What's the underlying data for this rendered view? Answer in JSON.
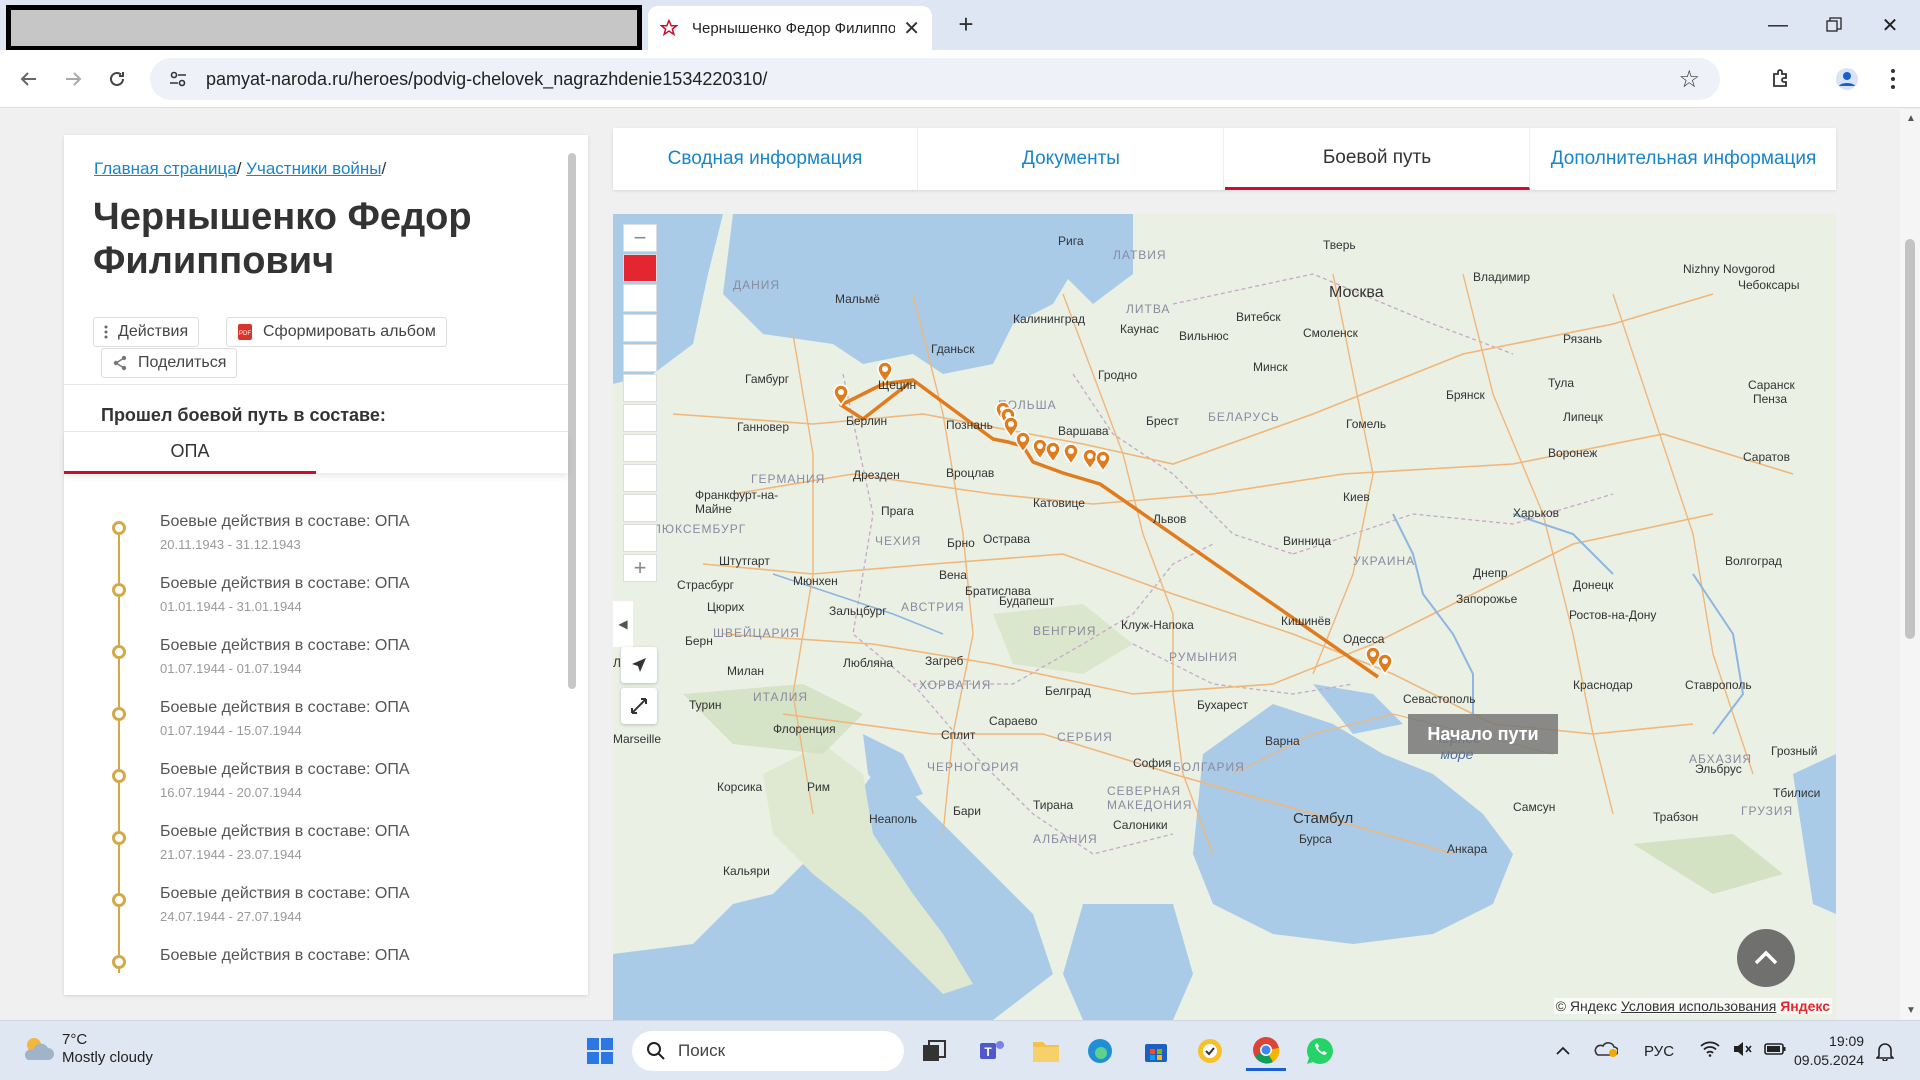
{
  "browser": {
    "tab_title": "Чернышенко Федор Филиппович",
    "new_tab": "+",
    "url": "pamyat-naroda.ru/heroes/podvig-chelovek_nagrazhdenie1534220310/"
  },
  "breadcrumb": {
    "home": "Главная страница",
    "participants": "Участники войны",
    "sep": "/"
  },
  "person": {
    "name": "Чернышенко Федор Филиппович"
  },
  "actions": {
    "actions_label": "Действия",
    "album_label": "Сформировать альбом",
    "share_label": "Поделиться"
  },
  "path": {
    "title": "Прошел боевой путь в составе:",
    "unit_tab": "ОПА"
  },
  "timeline": [
    {
      "title": "Боевые действия в составе: ОПА",
      "date": "20.11.1943 - 31.12.1943"
    },
    {
      "title": "Боевые действия в составе: ОПА",
      "date": "01.01.1944 - 31.01.1944"
    },
    {
      "title": "Боевые действия в составе: ОПА",
      "date": "01.07.1944 - 01.07.1944"
    },
    {
      "title": "Боевые действия в составе: ОПА",
      "date": "01.07.1944 - 15.07.1944"
    },
    {
      "title": "Боевые действия в составе: ОПА",
      "date": "16.07.1944 - 20.07.1944"
    },
    {
      "title": "Боевые действия в составе: ОПА",
      "date": "21.07.1944 - 23.07.1944"
    },
    {
      "title": "Боевые действия в составе: ОПА",
      "date": "24.07.1944 - 27.07.1944"
    },
    {
      "title": "Боевые действия в составе: ОПА",
      "date": ""
    }
  ],
  "main_tabs": {
    "summary": "Сводная информация",
    "documents": "Документы",
    "combat_path": "Боевой путь",
    "additional": "Дополнительная информация"
  },
  "map": {
    "start_label": "Начало пути",
    "attribution_prefix": "© Яндекс",
    "terms": "Условия использования",
    "brand": "Яндекс",
    "route_color": "#e07b1e",
    "labels": {
      "riga": "Рига",
      "latvia": "ЛАТВИЯ",
      "tver": "Тверь",
      "vladimir": "Владимир",
      "nizhny": "Nizhny Novgorod",
      "cheboksary": "Чебоксары",
      "denmark": "ДАНИЯ",
      "malmo": "Мальмё",
      "moscow": "Москва",
      "lithuania": "ЛИТВА",
      "vitebsk": "Витебск",
      "kaunas": "Каунас",
      "vilnius": "Вильнюс",
      "smolensk": "Смоленск",
      "gdansk": "Гданьск",
      "kaliningrad": "Калининград",
      "ryazan": "Рязань",
      "hamburg": "Гамбург",
      "shchetsin": "Щецин",
      "grodno": "Гродно",
      "minsk": "Минск",
      "tula": "Тула",
      "saransk": "Саранск",
      "poland": "ПОЛЬША",
      "belarus": "БЕЛАРУСЬ",
      "bryansk": "Брянск",
      "penza": "Пенза",
      "hannover": "Ганновер",
      "berlin": "Берлин",
      "poznan": "Познань",
      "varshava": "Варшава",
      "brest": "Брест",
      "gomel": "Гомель",
      "lipetsk": "Липецк",
      "voronezh": "Воронеж",
      "saratov": "Саратов",
      "germany": "ГЕРМАНИЯ",
      "dresden": "Дрезден",
      "wroclaw": "Вроцлав",
      "frankfurt": "Франкфурт-на-Майне",
      "praha": "Прага",
      "katowice": "Катовице",
      "lviv": "Львов",
      "kiev": "Киев",
      "kharkov": "Харьков",
      "luxembourg": "ЛЮКСЕМБУРГ",
      "czech": "ЧЕХИЯ",
      "brno": "Брно",
      "ostrava": "Острава",
      "vinnitsa": "Винница",
      "stuttgart": "Штутгарт",
      "ukraine": "УКРАИНА",
      "dnepr": "Днепр",
      "volgograd": "Волгоград",
      "strasbourg": "Страсбург",
      "munchen": "Мюнхен",
      "vena": "Вена",
      "bratislava": "Братислава",
      "zaporozhye": "Запорожье",
      "donetsk": "Донецк",
      "zurich": "Цюрих",
      "salzburg": "Зальцбург",
      "austria": "АВСТРИЯ",
      "budapest": "Будапешт",
      "rostov": "Ростов-на-Дону",
      "bern": "Берн",
      "switzerland": "ШВЕЙЦАРИЯ",
      "hungary": "ВЕНГРИЯ",
      "cluj": "Клуж-Напока",
      "kishinev": "Кишинёв",
      "odessa": "Одесса",
      "lion": "Лион",
      "milan": "Милан",
      "ljubljana": "Любляна",
      "zagreb": "Загреб",
      "romania": "РУМЫНИЯ",
      "krasnodar": "Краснодар",
      "stavropol": "Ставрополь",
      "turin": "Турин",
      "italy": "ИТАЛИЯ",
      "croatia": "ХОРВАТИЯ",
      "belgrad": "Белград",
      "bucharest": "Бухарест",
      "sevastopol": "Севастополь",
      "florence": "Флоренция",
      "sarajevo": "Сараево",
      "serbia": "СЕРБИЯ",
      "marseille": "Marseille",
      "split": "Сплит",
      "bulgaria": "БОЛГАРИЯ",
      "varna": "Варна",
      "black_sea": "Чёрное море",
      "abkhazia": "АБХАЗИЯ",
      "elbrus": "Эльбрус",
      "grozny": "Грозный",
      "montenegro": "ЧЕРНОГОРИЯ",
      "sofia": "София",
      "corsica": "Корсика",
      "roma": "Рим",
      "north_macedonia": "СЕВЕРНАЯ МАКЕДОНИЯ",
      "samsun": "Самсун",
      "tbilisi": "Тбилиси",
      "georgia": "ГРУЗИЯ",
      "trabzon": "Трабзон",
      "bari": "Бари",
      "tirana": "Тирана",
      "neapol": "Неаполь",
      "saloniki": "Салоники",
      "istanbul": "Стамбул",
      "albania": "АЛБАНИЯ",
      "bursa": "Бурса",
      "ankara": "Анкара",
      "cagliari": "Кальяри"
    }
  },
  "taskbar": {
    "temp": "7°C",
    "weather": "Mostly cloudy",
    "search": "Поиск",
    "lang": "РУС",
    "time": "19:09",
    "date": "09.05.2024"
  }
}
